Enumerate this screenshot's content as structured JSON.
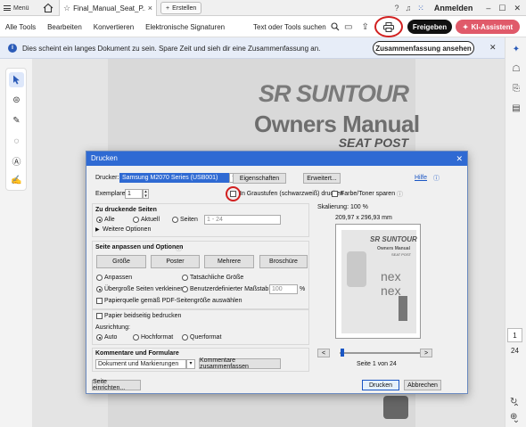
{
  "titlebar": {
    "menu_label": "Menü",
    "tab_title": "Final_Manual_Seat_P...",
    "new_tab_label": "Erstellen",
    "account_label": "Anmelden"
  },
  "toolbar": {
    "menu_items": [
      "Alle Tools",
      "Bearbeiten",
      "Konvertieren",
      "Elektronische Signaturen"
    ],
    "search_label": "Text oder Tools suchen",
    "share_label": "Freigeben",
    "ai_label": "KI-Assistent"
  },
  "infobar": {
    "message": "Dies scheint ein langes Dokument zu sein. Spare Zeit und sieh dir eine Zusammenfassung an.",
    "summary_button": "Zusammenfassung ansehen"
  },
  "document": {
    "brand": "SR SUNTOUR",
    "title": "Owners Manual",
    "subtitle": "SEAT POST"
  },
  "navigation": {
    "current_page": "1",
    "total_pages": "24"
  },
  "print_dialog": {
    "title": "Drucken",
    "printer_label": "Drucker:",
    "printer_value": "Samsung M2070 Series (USB001)",
    "properties_button": "Eigenschaften",
    "advanced_button": "Erweitert...",
    "help_link": "Hilfe",
    "copies_label": "Exemplare:",
    "copies_value": "1",
    "grayscale_label": "In Graustufen (schwarzweiß) drucken",
    "save_ink_label": "Farbe/Toner sparen",
    "pages_heading": "Zu druckende Seiten",
    "pages_all": "Alle",
    "pages_current": "Aktuell",
    "pages_range": "Seiten",
    "pages_range_value": "1 - 24",
    "more_options": "Weitere Optionen",
    "sizing_heading": "Seite anpassen und Optionen",
    "size_button": "Größe",
    "poster_button": "Poster",
    "multiple_button": "Mehrere",
    "booklet_button": "Broschüre",
    "fit_label": "Anpassen",
    "actual_size_label": "Tatsächliche Größe",
    "shrink_label": "Übergroße Seiten verkleinern",
    "custom_scale_label": "Benutzerdefinierter Maßstab:",
    "custom_scale_value": "100",
    "custom_scale_unit": "%",
    "paper_source_label": "Papierquelle gemäß PDF-Seitengröße auswählen",
    "duplex_label": "Papier beidseitig bedrucken",
    "orientation_heading": "Ausrichtung:",
    "orientation_auto": "Auto",
    "orientation_portrait": "Hochformat",
    "orientation_landscape": "Querformat",
    "comments_heading": "Kommentare und Formulare",
    "comments_value": "Dokument und Markierungen",
    "summarize_comments_button": "Kommentare zusammenfassen",
    "page_setup_button": "Seite einrichten...",
    "scale_label": "Skalierung: 100 %",
    "paper_dims": "209,97 x 296,93 mm",
    "preview_page_label": "Seite 1 von 24",
    "preview_prev": "<",
    "preview_next": ">",
    "print_button": "Drucken",
    "cancel_button": "Abbrechen",
    "preview_brand": "SR SUNTOUR",
    "preview_title": "Owners Manual",
    "preview_subtitle": "SEAT POST",
    "preview_product_1": "nex",
    "preview_product_2": "nex"
  },
  "colors": {
    "accent_blue": "#2f6ad3",
    "ai_button": "#e05a6a",
    "highlight_ring": "#d12020"
  }
}
